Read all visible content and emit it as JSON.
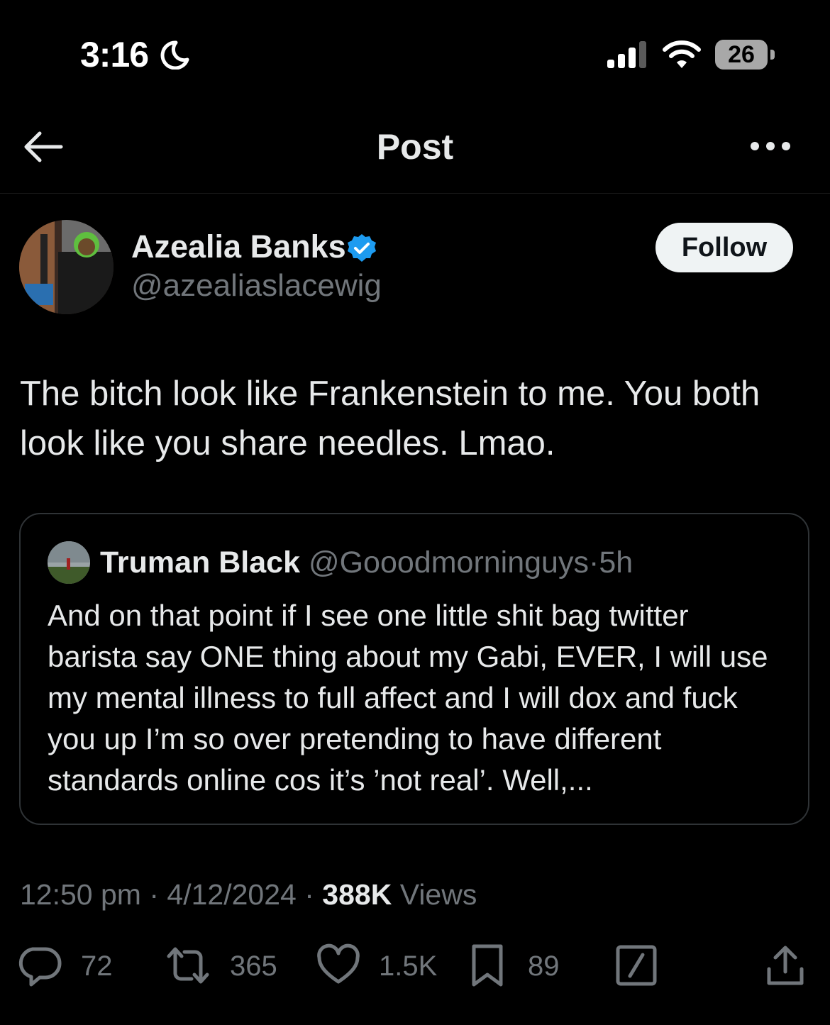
{
  "status_bar": {
    "time": "3:16",
    "battery": "26"
  },
  "nav": {
    "title": "Post"
  },
  "author": {
    "name": "Azealia Banks",
    "handle": "@azealiaslacewig",
    "follow_label": "Follow"
  },
  "tweet": {
    "text": "The bitch look like Frankenstein to me. You both look like you share needles. Lmao."
  },
  "quoted": {
    "name": "Truman Black",
    "handle": "@Gooodmorninguys",
    "separator": "·",
    "time": "5h",
    "text": "And on that point if I see one little shit bag twitter barista say ONE thing about my Gabi, EVER, I will use my mental illness to full affect and I will dox and fuck you up I’m so over pretending to have different standards online cos it’s ’not real’. Well,..."
  },
  "meta": {
    "time": "12:50 pm",
    "date": "4/12/2024",
    "views_count": "388K",
    "views_label": "Views",
    "separator": "·"
  },
  "actions": {
    "replies": "72",
    "reposts": "365",
    "likes": "1.5K",
    "bookmarks": "89"
  },
  "colors": {
    "background": "#000000",
    "text": "#e7e9ea",
    "secondary": "#71767b",
    "verified": "#1d9bf0",
    "border": "#2f3336"
  }
}
